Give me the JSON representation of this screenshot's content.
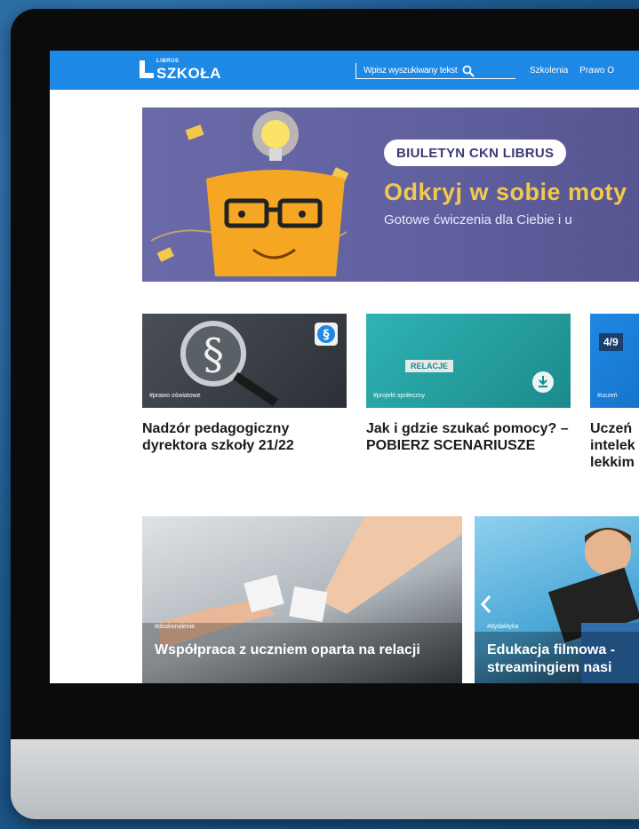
{
  "logo": {
    "small": "LIBRUS",
    "big": "SZKOŁA"
  },
  "search": {
    "placeholder": "Wpisz wyszukiwany tekst"
  },
  "nav": {
    "links": [
      "Szkolenia",
      "Prawo O"
    ]
  },
  "banner": {
    "chip": "BIULETYN CKN LIBRUS",
    "headline": "Odkryj w sobie moty",
    "subline": "Gotowe ćwiczenia dla Ciebie i u"
  },
  "cards": [
    {
      "tag": "#prawo oświatowe",
      "title": "Nadzór pedagogiczny dyrektora szkoły 21/22"
    },
    {
      "tag": "#projekt społeczny",
      "title": "Jak i gdzie szukać pomocy? – POBIERZ SCENARIUSZE",
      "thumb_text": "RELACJE"
    },
    {
      "tag": "#uczeń",
      "title": "Uczeń intelek lekkim",
      "thumb_text": "4/9"
    }
  ],
  "tiles": [
    {
      "tag": "#doskonalenie",
      "title": "Współpraca z uczniem oparta na relacji"
    },
    {
      "tag": "#dydaktyka",
      "title": "Edukacja filmowa -",
      "title2": "streamingiem nasi"
    }
  ],
  "colors": {
    "nav": "#1e88e5",
    "banner": "#605f9e",
    "headline": "#f2c94c"
  }
}
